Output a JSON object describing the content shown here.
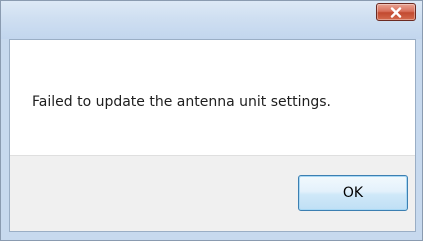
{
  "dialog": {
    "title": "",
    "message": "Failed to update the antenna unit settings.",
    "ok_label": "OK",
    "close_icon": "close-icon"
  },
  "colors": {
    "close_button": "#c94b33",
    "ok_border": "#3c7fb1",
    "title_bar": "#c7d9ee",
    "button_bar": "#f0f0f0"
  }
}
